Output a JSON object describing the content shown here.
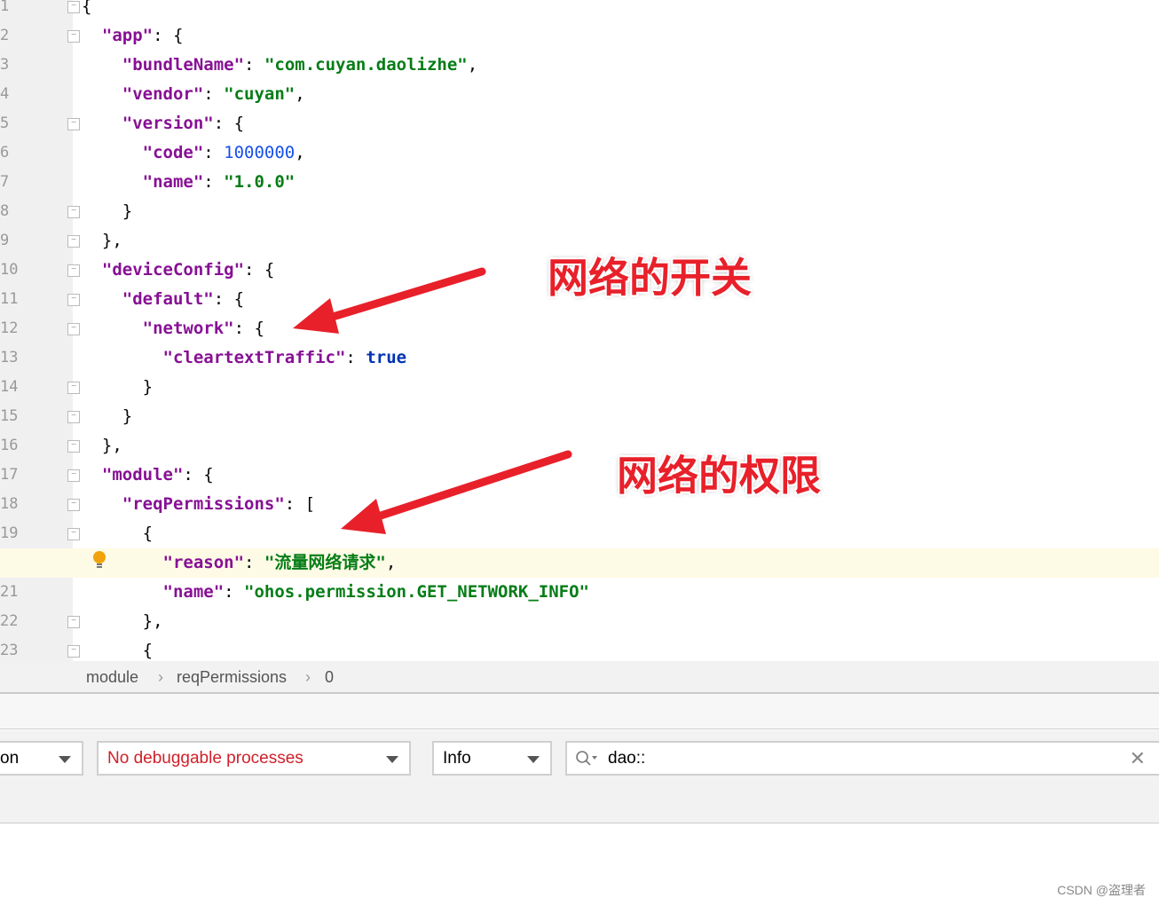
{
  "editor": {
    "highlighted_line": 20,
    "lines": [
      [
        [
          "p",
          "{"
        ]
      ],
      [
        [
          "p",
          "  "
        ],
        [
          "k",
          "\"app\""
        ],
        [
          "p",
          ": {"
        ]
      ],
      [
        [
          "p",
          "    "
        ],
        [
          "k",
          "\"bundleName\""
        ],
        [
          "p",
          ": "
        ],
        [
          "s",
          "\"com.cuyan.daolizhe\""
        ],
        [
          "p",
          ","
        ]
      ],
      [
        [
          "p",
          "    "
        ],
        [
          "k",
          "\"vendor\""
        ],
        [
          "p",
          ": "
        ],
        [
          "s",
          "\"cuyan\""
        ],
        [
          "p",
          ","
        ]
      ],
      [
        [
          "p",
          "    "
        ],
        [
          "k",
          "\"version\""
        ],
        [
          "p",
          ": {"
        ]
      ],
      [
        [
          "p",
          "      "
        ],
        [
          "k",
          "\"code\""
        ],
        [
          "p",
          ": "
        ],
        [
          "n",
          "1000000"
        ],
        [
          "p",
          ","
        ]
      ],
      [
        [
          "p",
          "      "
        ],
        [
          "k",
          "\"name\""
        ],
        [
          "p",
          ": "
        ],
        [
          "s",
          "\"1.0.0\""
        ]
      ],
      [
        [
          "p",
          "    }"
        ]
      ],
      [
        [
          "p",
          "  },"
        ]
      ],
      [
        [
          "p",
          "  "
        ],
        [
          "k",
          "\"deviceConfig\""
        ],
        [
          "p",
          ": {"
        ]
      ],
      [
        [
          "p",
          "    "
        ],
        [
          "k",
          "\"default\""
        ],
        [
          "p",
          ": {"
        ]
      ],
      [
        [
          "p",
          "      "
        ],
        [
          "k",
          "\"network\""
        ],
        [
          "p",
          ": {"
        ]
      ],
      [
        [
          "p",
          "        "
        ],
        [
          "k",
          "\"cleartextTraffic\""
        ],
        [
          "p",
          ": "
        ],
        [
          "b",
          "true"
        ]
      ],
      [
        [
          "p",
          "      }"
        ]
      ],
      [
        [
          "p",
          "    }"
        ]
      ],
      [
        [
          "p",
          "  },"
        ]
      ],
      [
        [
          "p",
          "  "
        ],
        [
          "k",
          "\"module\""
        ],
        [
          "p",
          ": {"
        ]
      ],
      [
        [
          "p",
          "    "
        ],
        [
          "k",
          "\"reqPermissions\""
        ],
        [
          "p",
          ": ["
        ]
      ],
      [
        [
          "p",
          "      {"
        ]
      ],
      [
        [
          "p",
          "        "
        ],
        [
          "k",
          "\"reason\""
        ],
        [
          "p",
          ": "
        ],
        [
          "s",
          "\"流量网络请求\""
        ],
        [
          "p",
          ","
        ]
      ],
      [
        [
          "p",
          "        "
        ],
        [
          "k",
          "\"name\""
        ],
        [
          "p",
          ": "
        ],
        [
          "s",
          "\"ohos.permission.GET_NETWORK_INFO\""
        ]
      ],
      [
        [
          "p",
          "      },"
        ]
      ],
      [
        [
          "p",
          "      {"
        ]
      ]
    ]
  },
  "annotations": {
    "network_switch": "网络的开关",
    "network_permission": "网络的权限",
    "color": "#e8202a"
  },
  "breadcrumb": [
    "module",
    "reqPermissions",
    "0"
  ],
  "toolbar": {
    "device_select": "on",
    "process_select": "No debuggable processes",
    "level_select": "Info",
    "search_value": "dao::"
  },
  "watermark": "CSDN @盗理者"
}
